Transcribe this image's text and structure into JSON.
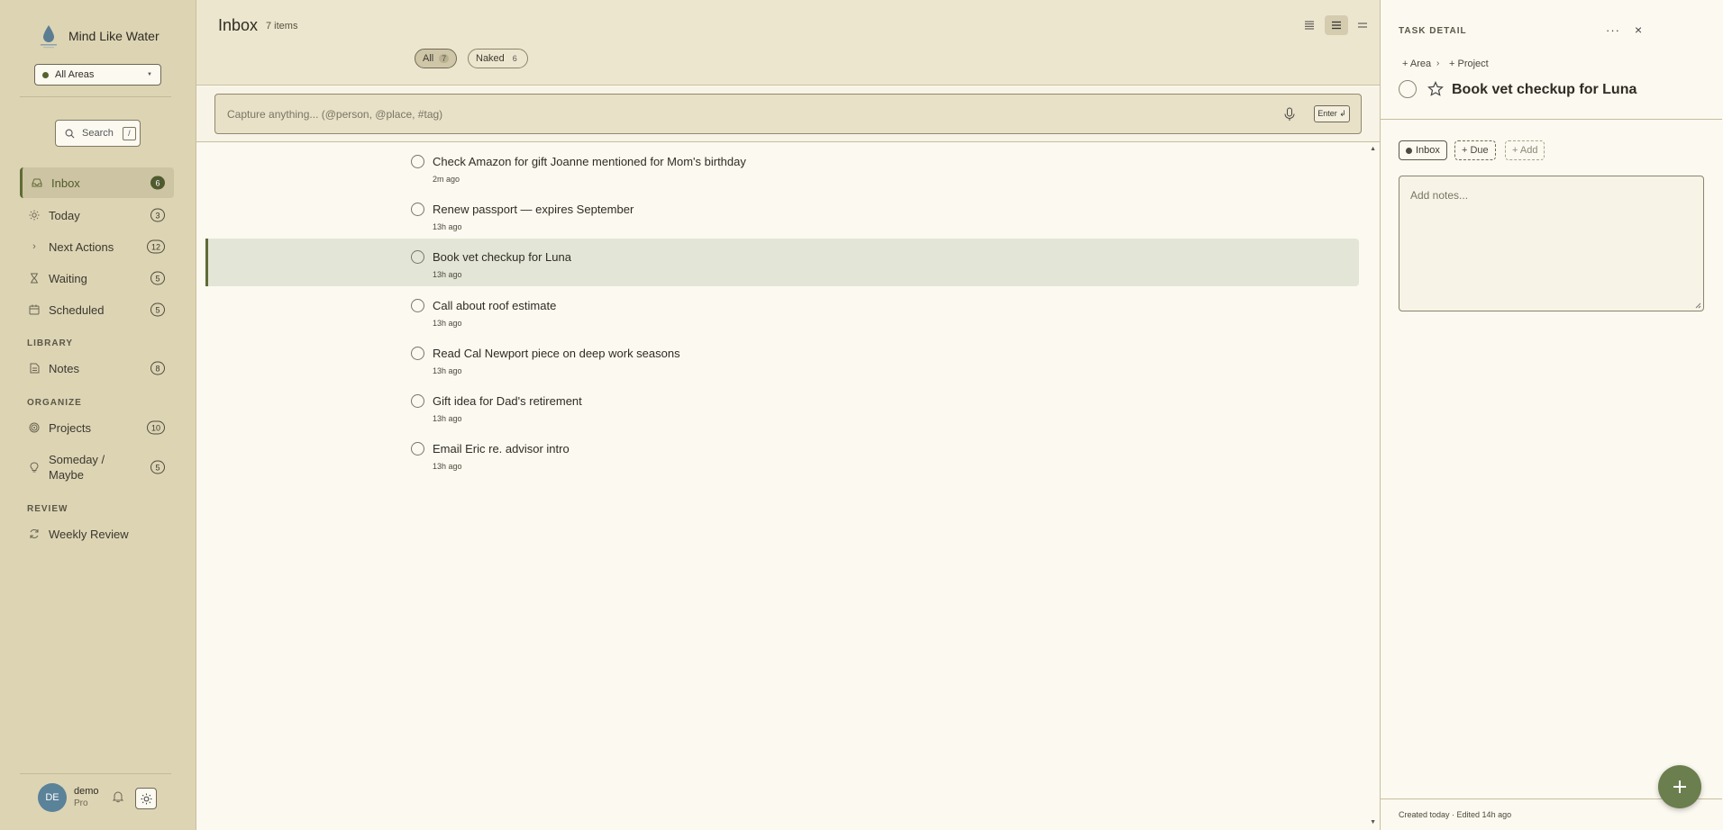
{
  "app": {
    "name": "Mind Like Water",
    "area_select": "All Areas",
    "search_label": "Search",
    "search_shortcut": "/"
  },
  "sidebar": {
    "items": [
      {
        "label": "Inbox",
        "count": "6",
        "icon": "inbox-icon",
        "active": true
      },
      {
        "label": "Today",
        "count": "3",
        "icon": "sun-icon"
      },
      {
        "label": "Next Actions",
        "count": "12",
        "icon": "chevron-right-icon"
      },
      {
        "label": "Waiting",
        "count": "5",
        "icon": "hourglass-icon"
      },
      {
        "label": "Scheduled",
        "count": "5",
        "icon": "calendar-icon"
      }
    ],
    "library_label": "LIBRARY",
    "library_items": [
      {
        "label": "Notes",
        "count": "8",
        "icon": "document-icon"
      }
    ],
    "organize_label": "ORGANIZE",
    "organize_items": [
      {
        "label": "Projects",
        "count": "10",
        "icon": "target-icon"
      },
      {
        "label": "Someday / Maybe",
        "count": "5",
        "icon": "lightbulb-icon"
      }
    ],
    "review_label": "REVIEW",
    "review_items": [
      {
        "label": "Weekly Review",
        "icon": "refresh-icon"
      }
    ]
  },
  "user": {
    "initials": "DE",
    "name": "demo",
    "plan": "Pro"
  },
  "main": {
    "title": "Inbox",
    "count_label": "7 items",
    "filters": [
      {
        "label": "All",
        "count": "7",
        "active": true
      },
      {
        "label": "Naked",
        "count": "6"
      }
    ],
    "capture_placeholder": "Capture anything... (@person, @place, #tag)",
    "enter_label": "Enter ↲",
    "tasks": [
      {
        "title": "Check Amazon for gift Joanne mentioned for Mom's birthday",
        "time": "2m ago"
      },
      {
        "title": "Renew passport — expires September",
        "time": "13h ago"
      },
      {
        "title": "Book vet checkup for Luna",
        "time": "13h ago",
        "selected": true
      },
      {
        "title": "Call about roof estimate",
        "time": "13h ago"
      },
      {
        "title": "Read Cal Newport piece on deep work seasons",
        "time": "13h ago"
      },
      {
        "title": "Gift idea for Dad's retirement",
        "time": "13h ago"
      },
      {
        "title": "Email Eric re. advisor intro",
        "time": "13h ago"
      }
    ]
  },
  "detail": {
    "header": "TASK DETAIL",
    "more": "···",
    "close": "×",
    "crumb_area": "+ Area",
    "crumb_sep": "›",
    "crumb_project": "+ Project",
    "title": "Book vet checkup for Luna",
    "chip_inbox": "Inbox",
    "chip_due": "+ Due",
    "chip_add": "+ Add",
    "notes_placeholder": "Add notes...",
    "footer": "Created today · Edited 14h ago"
  },
  "colors": {
    "sidebar_bg": "#ddd4b4",
    "accent": "#5e6b35",
    "fab": "#6b7e4e"
  }
}
